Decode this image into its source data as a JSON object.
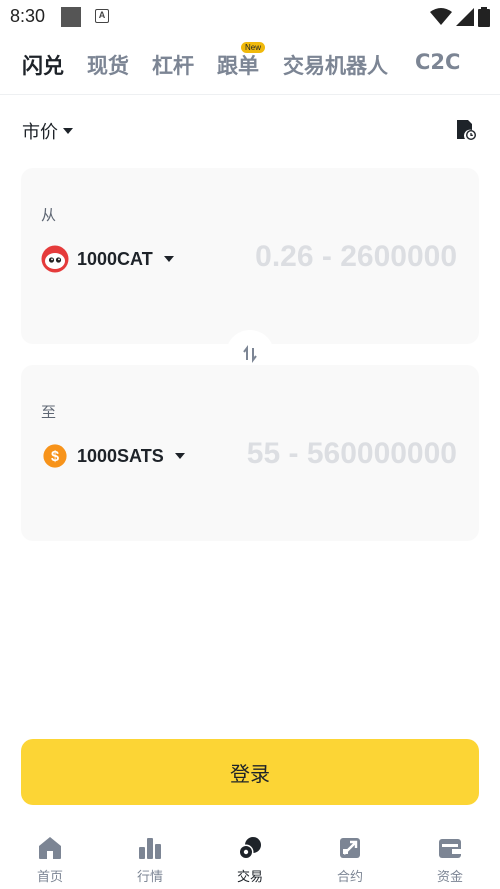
{
  "status_bar": {
    "time": "8:30"
  },
  "tabs": [
    {
      "label": "闪兑",
      "active": true
    },
    {
      "label": "现货",
      "active": false
    },
    {
      "label": "杠杆",
      "active": false
    },
    {
      "label": "跟单",
      "active": false,
      "badge": "New"
    },
    {
      "label": "交易机器人",
      "active": false
    },
    {
      "label": "C2C",
      "active": false
    }
  ],
  "price_type": {
    "label": "市价"
  },
  "from_card": {
    "label": "从",
    "coin": "1000CAT",
    "placeholder": "0.26 - 2600000"
  },
  "to_card": {
    "label": "至",
    "coin": "1000SATS",
    "placeholder": "55 - 560000000"
  },
  "login_button": {
    "label": "登录"
  },
  "bottom_nav": [
    {
      "label": "首页",
      "icon": "home-icon"
    },
    {
      "label": "行情",
      "icon": "markets-icon"
    },
    {
      "label": "交易",
      "icon": "trade-icon",
      "active": true
    },
    {
      "label": "合约",
      "icon": "futures-icon"
    },
    {
      "label": "资金",
      "icon": "wallet-icon"
    }
  ],
  "colors": {
    "accent": "#fcd535",
    "badge": "#f0b90b",
    "text": "#1e2329",
    "muted": "#7c8594",
    "card_bg": "#f9f9f9"
  }
}
